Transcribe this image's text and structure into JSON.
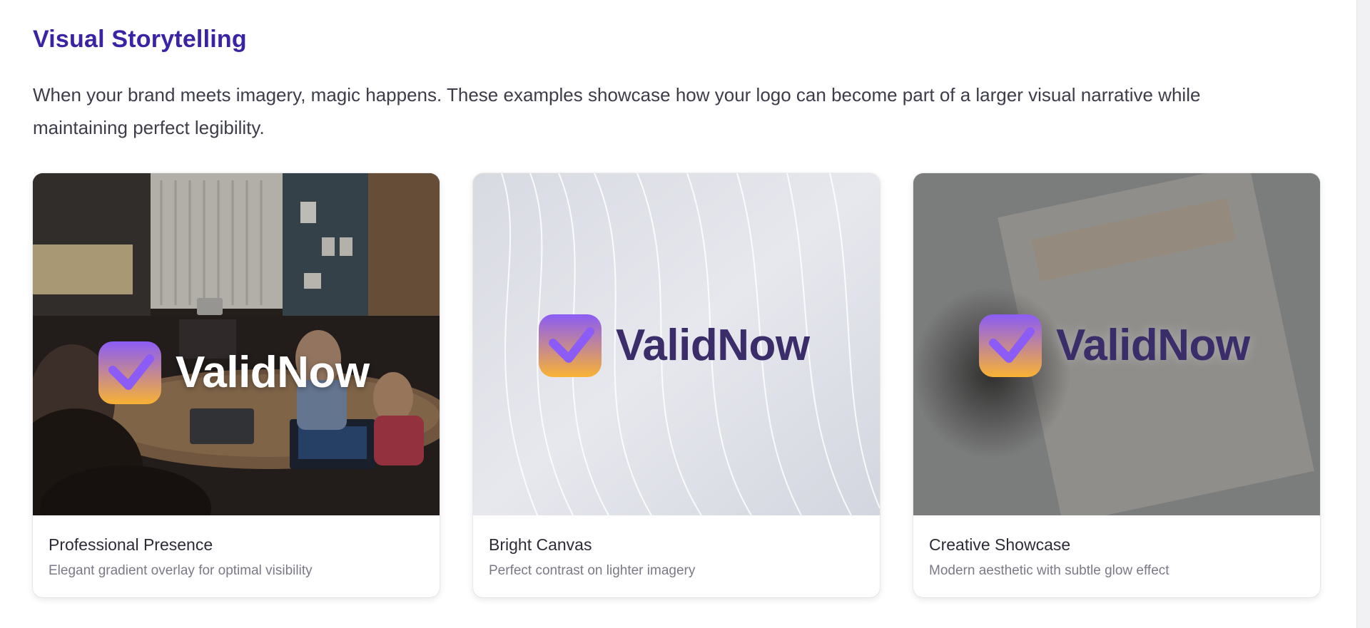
{
  "section": {
    "title": "Visual Storytelling",
    "description": "When your brand meets imagery, magic happens. These examples showcase how your logo can become part of a larger visual narrative while maintaining perfect legibility."
  },
  "brand": {
    "wordmark": "ValidNow",
    "icon": "validnow-check-badge-icon",
    "gradient_start": "#8b5cf6",
    "gradient_end": "#f9b233",
    "accent": "#3b23a6"
  },
  "cards": [
    {
      "title": "Professional Presence",
      "subtitle": "Elegant gradient overlay for optimal visibility",
      "image": "meeting-room-photo"
    },
    {
      "title": "Bright Canvas",
      "subtitle": "Perfect contrast on lighter imagery",
      "image": "abstract-white-waves"
    },
    {
      "title": "Creative Showcase",
      "subtitle": "Modern aesthetic with subtle glow effect",
      "image": "blurred-grey-desk-photo"
    }
  ]
}
